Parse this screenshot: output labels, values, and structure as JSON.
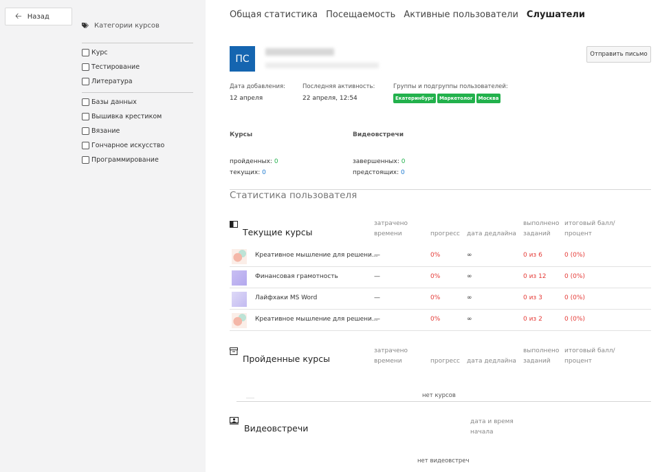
{
  "sidebar": {
    "back_label": "Назад",
    "categories_title": "Категории курсов",
    "group1": [
      "Курс",
      "Тестирование",
      "Литература"
    ],
    "group2": [
      "Базы данных",
      "Вышивка крестиком",
      "Вязание",
      "Гончарное искусство",
      "Программирование"
    ]
  },
  "tabs": [
    "Общая статистика",
    "Посещаемость",
    "Активные пользователи",
    "Слушатели"
  ],
  "active_tab": "Слушатели",
  "user": {
    "initials": "ПС",
    "send_label": "Отправить письмо"
  },
  "meta": {
    "added_label": "Дата добавления:",
    "added_value": "12 апреля",
    "activity_label": "Последняя активность:",
    "activity_value": "22 апреля, 12:54",
    "groups_label": "Группы и подгруппы пользователей:",
    "groups": [
      "Екатеринбург",
      "Маркетолог",
      "Москва"
    ],
    "tag_color": "#22b14c"
  },
  "summary": {
    "courses_title": "Курсы",
    "passed_label": "пройденных:",
    "passed_value": "0",
    "current_label": "текущих:",
    "current_value": "0",
    "meetings_title": "Видеовстречи",
    "finished_label": "завершенных:",
    "finished_value": "0",
    "upcoming_label": "предстоящих:",
    "upcoming_value": "0"
  },
  "stats_title": "Статистика пользователя",
  "columns": {
    "time": "затрачено времени",
    "progress": "прогресс",
    "deadline": "дата дедлайна",
    "done": "выполнено заданий",
    "score": "итоговый балл/процент"
  },
  "current_courses": {
    "title": "Текущие курсы",
    "rows": [
      {
        "name": "Креативное мышление для решени...",
        "time": "—",
        "progress": "0%",
        "deadline": "∞",
        "done": "0 из 6",
        "score": "0 (0%)",
        "thumb": "art"
      },
      {
        "name": "Финансовая грамотность",
        "time": "—",
        "progress": "0%",
        "deadline": "∞",
        "done": "0 из 12",
        "score": "0 (0%)",
        "thumb": "lilac"
      },
      {
        "name": "Лайфхаки MS Word",
        "time": "—",
        "progress": "0%",
        "deadline": "∞",
        "done": "0 из 3",
        "score": "0 (0%)",
        "thumb": "lilac2"
      },
      {
        "name": "Креативное мышление для решени...",
        "time": "—",
        "progress": "0%",
        "deadline": "∞",
        "done": "0 из 2",
        "score": "0 (0%)",
        "thumb": "art"
      }
    ]
  },
  "passed_courses": {
    "title": "Пройденные курсы",
    "empty": "нет курсов"
  },
  "meetings": {
    "title": "Видеовстречи",
    "datetime_head": "дата и время начала",
    "empty": "нет видеовстреч"
  }
}
